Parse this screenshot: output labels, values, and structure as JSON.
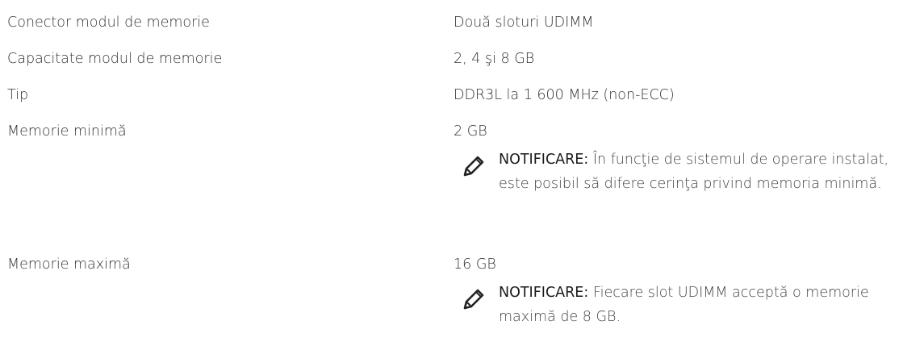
{
  "rows": [
    {
      "label": "Conector modul de memorie",
      "value": "Două sloturi UDIMM"
    },
    {
      "label": "Capacitate modul de memorie",
      "value": "2, 4 şi 8 GB"
    },
    {
      "label": "Tip",
      "value": "DDR3L la 1 600 MHz (non-ECC)"
    },
    {
      "label": "Memorie minimă",
      "value": "2 GB"
    },
    {
      "label": "Memorie maximă",
      "value": "16 GB"
    }
  ],
  "notes": [
    {
      "icon": "pencil-icon",
      "label": "NOTIFICARE:",
      "text": " În funcţie de sistemul de operare instalat, este posibil să difere cerinţa privind memoria minimă."
    },
    {
      "icon": "pencil-icon",
      "label": "NOTIFICARE:",
      "text": " Fiecare slot UDIMM acceptă o memorie maximă de 8 GB."
    }
  ]
}
